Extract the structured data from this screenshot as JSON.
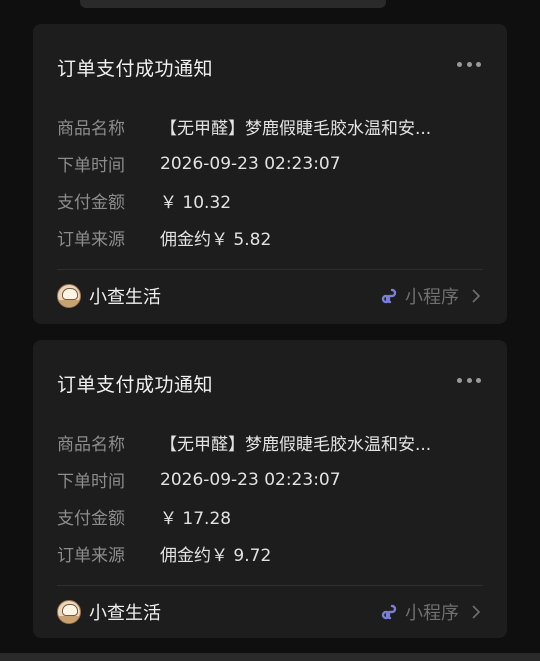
{
  "cards": [
    {
      "title": "订单支付成功通知",
      "rows": [
        {
          "label": "商品名称",
          "value": "【无甲醛】梦鹿假睫毛胶水温和安..."
        },
        {
          "label": "下单时间",
          "value": "2026-09-23 02:23:07"
        },
        {
          "label": "支付金额",
          "value": "￥ 10.32"
        },
        {
          "label": "订单来源",
          "value": "佣金约￥ 5.82"
        }
      ],
      "footer": {
        "brand": "小查生活",
        "mini_program": "小程序"
      }
    },
    {
      "title": "订单支付成功通知",
      "rows": [
        {
          "label": "商品名称",
          "value": "【无甲醛】梦鹿假睫毛胶水温和安..."
        },
        {
          "label": "下单时间",
          "value": "2026-09-23 02:23:07"
        },
        {
          "label": "支付金额",
          "value": "￥ 17.28"
        },
        {
          "label": "订单来源",
          "value": "佣金约￥ 9.72"
        }
      ],
      "footer": {
        "brand": "小查生活",
        "mini_program": "小程序"
      }
    }
  ],
  "colors": {
    "background": "#0f0f0f",
    "card": "#1d1d1d",
    "mini_program_icon": "#7b7fd6"
  }
}
